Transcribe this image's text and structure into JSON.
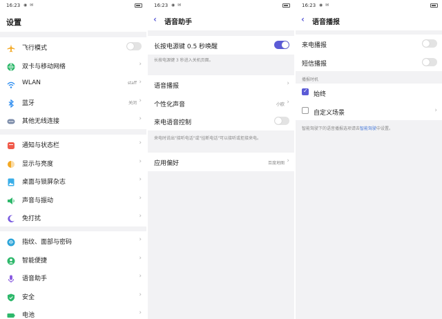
{
  "status": {
    "time": "16:23"
  },
  "settings": {
    "title": "设置",
    "groups": [
      {
        "items": [
          {
            "label": "飞行模式",
            "icon": "airplane-icon",
            "color": "#f3a823",
            "control": "toggle",
            "on": false
          },
          {
            "label": "双卡与移动网络",
            "icon": "globe-icon",
            "color": "#2eb86b",
            "control": "chevron"
          },
          {
            "label": "WLAN",
            "icon": "wifi-icon",
            "color": "#2f8ef0",
            "value": "staff",
            "control": "chevron"
          },
          {
            "label": "蓝牙",
            "icon": "bluetooth-icon",
            "color": "#2f8ef0",
            "value": "关闭",
            "control": "chevron"
          },
          {
            "label": "其他无线连接",
            "icon": "dots-icon",
            "color": "#7a8aa8",
            "control": "chevron"
          }
        ]
      },
      {
        "items": [
          {
            "label": "通知与状态栏",
            "icon": "notification-icon",
            "color": "#f05a4a",
            "control": "chevron"
          },
          {
            "label": "显示与亮度",
            "icon": "brightness-icon",
            "color": "#f3a823",
            "control": "chevron"
          },
          {
            "label": "桌面与锁屏杂志",
            "icon": "wallpaper-icon",
            "color": "#3aaee8",
            "control": "chevron"
          },
          {
            "label": "声音与振动",
            "icon": "sound-icon",
            "color": "#2eb86b",
            "control": "chevron"
          },
          {
            "label": "免打扰",
            "icon": "moon-icon",
            "color": "#7a5ce0",
            "control": "chevron"
          }
        ]
      },
      {
        "items": [
          {
            "label": "指纹、面部与密码",
            "icon": "fingerprint-icon",
            "color": "#2aa3d8",
            "control": "chevron"
          },
          {
            "label": "智能便捷",
            "icon": "smart-icon",
            "color": "#2eb86b",
            "control": "chevron"
          },
          {
            "label": "语音助手",
            "icon": "microphone-icon",
            "color": "#8a5ce0",
            "control": "chevron"
          },
          {
            "label": "安全",
            "icon": "shield-icon",
            "color": "#2eb86b",
            "control": "chevron"
          },
          {
            "label": "电池",
            "icon": "battery-icon",
            "color": "#2eb86b",
            "control": "chevron"
          }
        ]
      }
    ]
  },
  "assistant": {
    "title": "语音助手",
    "power_label": "长按电源键 0.5 秒唤醒",
    "power_on": true,
    "power_hint": "长按电源键 3 秒进入关机页面。",
    "items": [
      {
        "label": "语音播报",
        "control": "chevron"
      },
      {
        "label": "个性化声音",
        "value": "小欧",
        "control": "chevron"
      },
      {
        "label": "来电语音控制",
        "control": "toggle",
        "on": false
      }
    ],
    "call_hint": "来电时说出\"接听电话\"或\"挂断电话\"可以接听或拒接来电。",
    "pref_label": "应用偏好",
    "pref_value": "百度地图"
  },
  "broadcast": {
    "title": "语音播报",
    "toggles": [
      {
        "label": "来电播报",
        "on": false
      },
      {
        "label": "短信播报",
        "on": false
      }
    ],
    "timing_header": "播报时机",
    "options": [
      {
        "label": "始终",
        "checked": true
      },
      {
        "label": "自定义场景",
        "checked": false
      }
    ],
    "footer_pre": "智能驾驶下的语音播报选项请去",
    "footer_link": "智能驾驶",
    "footer_post": "中设置。"
  }
}
